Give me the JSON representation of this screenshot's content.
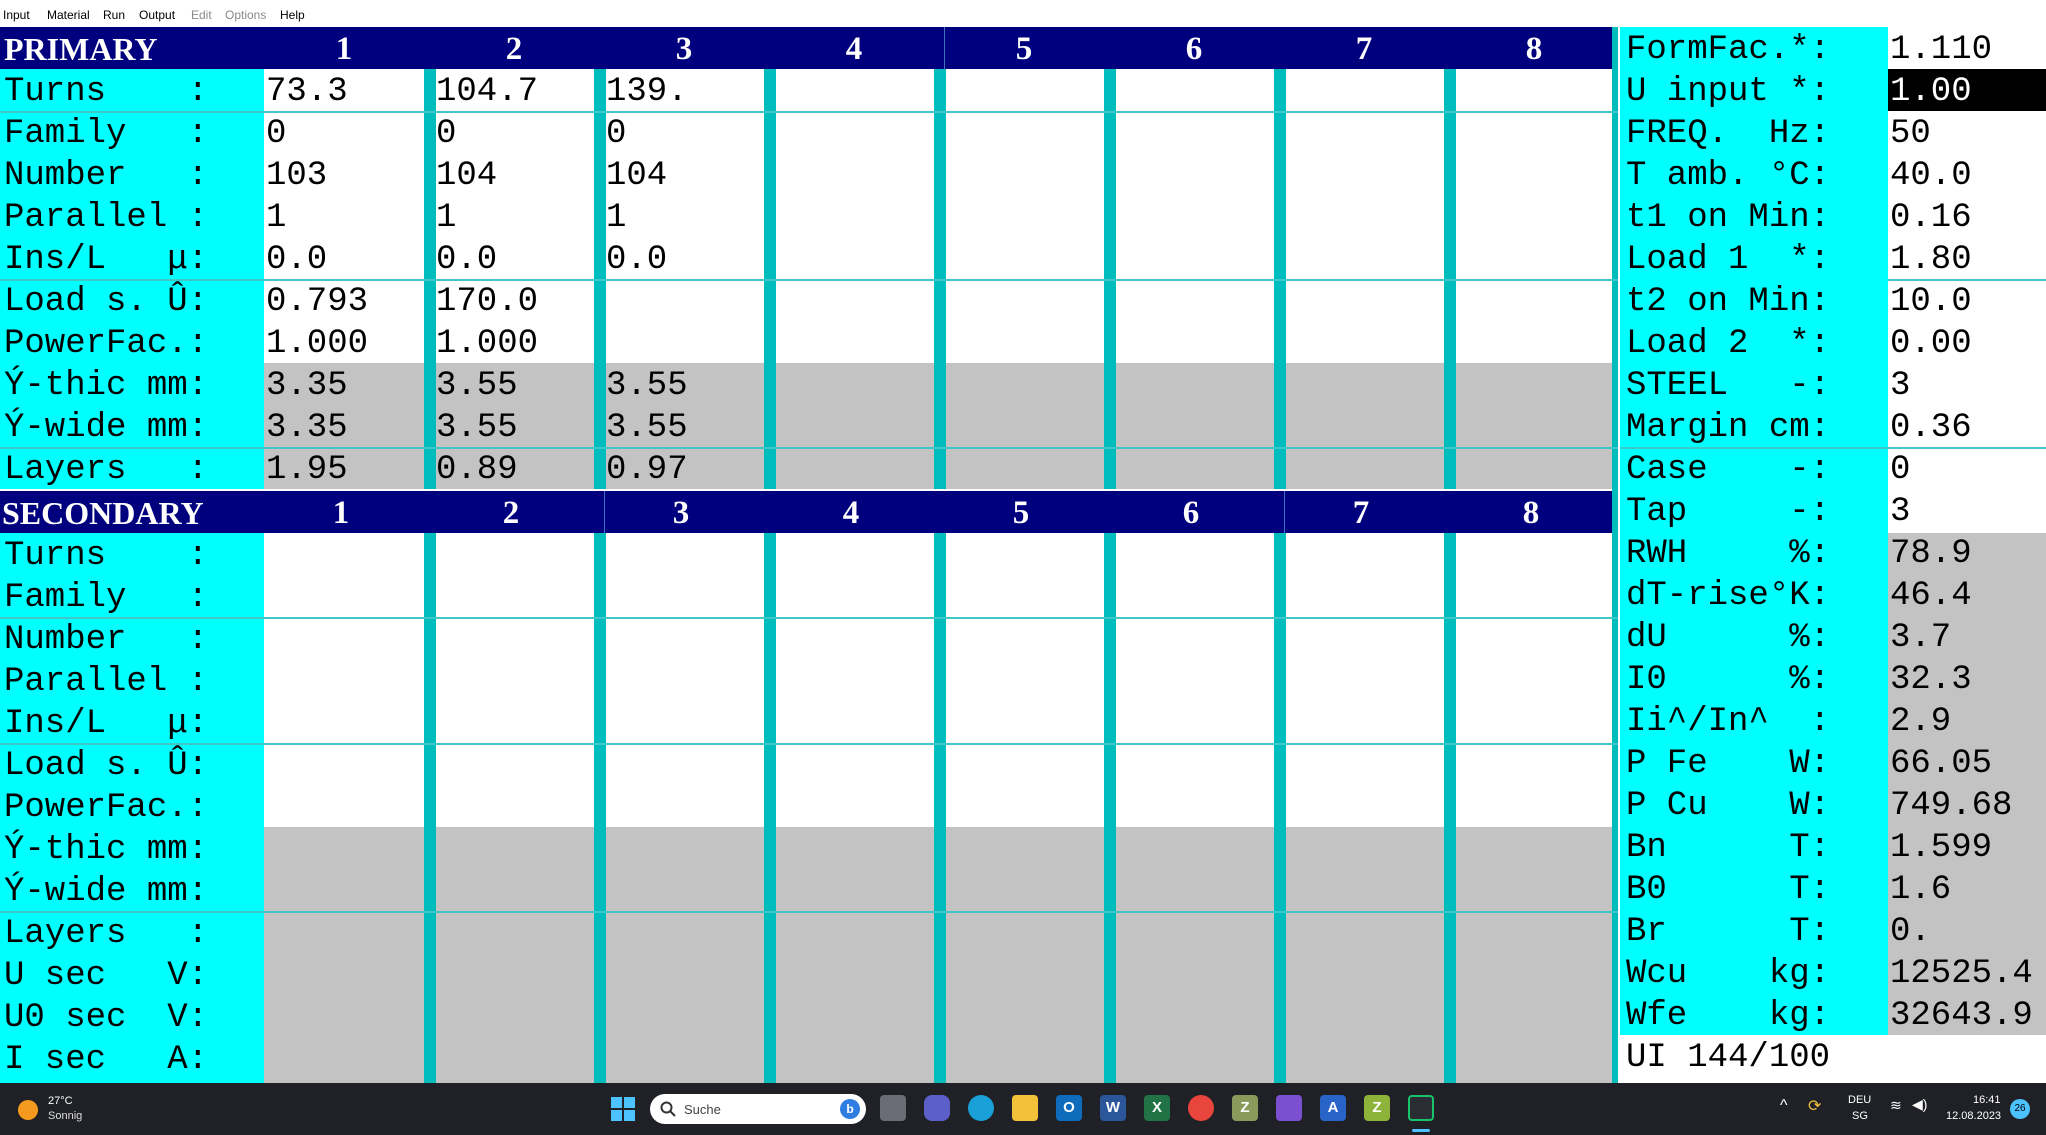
{
  "menu": [
    {
      "label": "Input",
      "enabled": true
    },
    {
      "label": "Material",
      "enabled": true
    },
    {
      "label": "Run",
      "enabled": true
    },
    {
      "label": "Output",
      "enabled": true
    },
    {
      "label": "Edit",
      "enabled": false
    },
    {
      "label": "Options",
      "enabled": false
    },
    {
      "label": "Help",
      "enabled": true
    }
  ],
  "primary": {
    "title": "PRIMARY",
    "columns": [
      "1",
      "2",
      "3",
      "4",
      "5",
      "6",
      "7",
      "8"
    ],
    "labels": [
      "Turns    :",
      "Family   :",
      "Number   :",
      "Parallel :",
      "Ins/L   μ:",
      "Load s. Û:",
      "PowerFac.:",
      "Ý-thic mm:",
      "Ý-wide mm:",
      "Layers   :"
    ],
    "values": [
      [
        "73.3",
        "104.7",
        "139."
      ],
      [
        "0",
        "0",
        "0"
      ],
      [
        "103",
        "104",
        "104"
      ],
      [
        "1",
        "1",
        "1"
      ],
      [
        "0.0",
        "0.0",
        "0.0"
      ],
      [
        "0.793",
        "170.0",
        ""
      ],
      [
        "1.000",
        "1.000",
        ""
      ],
      [
        "3.35",
        "3.55",
        "3.55"
      ],
      [
        "3.35",
        "3.55",
        "3.55"
      ],
      [
        "1.95",
        "0.89",
        "0.97"
      ]
    ]
  },
  "secondary": {
    "title": "SECONDARY",
    "columns": [
      "1",
      "2",
      "3",
      "4",
      "5",
      "6",
      "7",
      "8"
    ],
    "labels": [
      "Turns    :",
      "Family   :",
      "Number   :",
      "Parallel :",
      "Ins/L   μ:",
      "Load s. Û:",
      "PowerFac.:",
      "Ý-thic mm:",
      "Ý-wide mm:",
      "Layers   :",
      "U sec   V:",
      "U0 sec  V:",
      "I sec   A:"
    ]
  },
  "params": {
    "labels": [
      "FormFac.*:",
      "U input *:",
      "FREQ.  Hz:",
      "T amb. °C:",
      "t1 on Min:",
      "Load 1  *:",
      "t2 on Min:",
      "Load 2  *:",
      "STEEL   -:",
      "Margin cm:",
      "Case    -:",
      "Tap     -:"
    ],
    "values": [
      "1.110",
      "1.00",
      "50",
      "40.0",
      "0.16",
      "1.80",
      "10.0",
      "0.00",
      "3",
      "0.36",
      "0",
      "3"
    ]
  },
  "results": {
    "labels": [
      "RWH     %:",
      "dT-rise°K:",
      "dU      %:",
      "I0      %:",
      "Ii^/In^  :",
      "P Fe    W:",
      "P Cu    W:",
      "Bn      T:",
      "B0      T:",
      "Br      T:",
      "Wcu    kg:",
      "Wfe    kg:"
    ],
    "values": [
      "78.9",
      "46.4",
      "3.7",
      "32.3",
      "2.9",
      "66.05",
      "749.68",
      "1.599",
      "1.6",
      "0.",
      "12525.4",
      "32643.9"
    ]
  },
  "ui_label": "UI 144/100",
  "taskbar": {
    "weather_temp": "27°C",
    "weather_desc": "Sonnig",
    "search_placeholder": "Suche",
    "lang": "DEU",
    "region": "SG",
    "time": "16:41",
    "date": "12.08.2023",
    "notif_count": "26"
  },
  "colors": {
    "header": "#00007f",
    "label_bg": "#00ffff",
    "separator": "#00bdbd",
    "gray_cells": "#c3c3c3"
  }
}
